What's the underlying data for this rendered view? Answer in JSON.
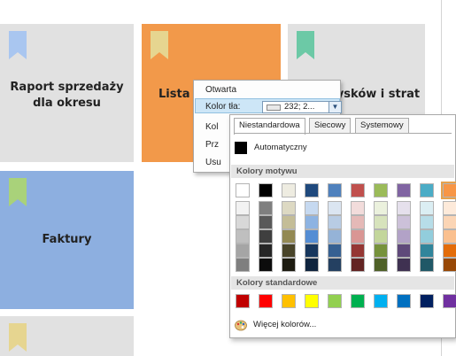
{
  "tiles": [
    {
      "label": "Raport sprzedaży dla okresu",
      "color": "#e1e1e1",
      "ribbon_color": "#a9c6f0"
    },
    {
      "label": "Lista P",
      "color": "#f2994a",
      "ribbon_color": "#e6d590"
    },
    {
      "label": "...ysków i strat",
      "color": "#e1e1e1",
      "ribbon_color": "#6cc9a6"
    },
    {
      "label": "Faktury",
      "color": "#8dafe0",
      "ribbon_color": "#a9d27a"
    },
    {
      "label": "",
      "color": "#e1e1e1",
      "ribbon_color": "#e6d590"
    }
  ],
  "context_menu": {
    "items": [
      "Otwarta",
      "Kolor tła:",
      "Kol",
      "Prz",
      "Usu"
    ],
    "combo_value": "232; 2...",
    "combo_arrow_icon": "chevron-down-icon"
  },
  "color_picker": {
    "tabs": [
      "Niestandardowa",
      "Siecowy",
      "Systemowy"
    ],
    "active_tab": 0,
    "automatic_label": "Automatyczny",
    "theme_colors_label": "Kolory motywu",
    "standard_colors_label": "Kolory standardowe",
    "more_colors_label": "Więcej kolorów...",
    "more_colors_icon": "palette-icon",
    "theme_base": [
      "#ffffff",
      "#000000",
      "#eeece1",
      "#1f497d",
      "#4f81bd",
      "#c0504d",
      "#9bbb59",
      "#8064a2",
      "#4bacc6",
      "#f79646"
    ],
    "theme_shades": [
      [
        "#f2f2f2",
        "#7f7f7f",
        "#ddd9c3",
        "#c6d9f0",
        "#dbe5f1",
        "#f2dcdb",
        "#ebf1dd",
        "#e5e0ec",
        "#dbeef3",
        "#fdeada"
      ],
      [
        "#d8d8d8",
        "#595959",
        "#c4bd97",
        "#8db3e2",
        "#b8cce4",
        "#e5b9b7",
        "#d7e3bc",
        "#ccc1d9",
        "#b7dde8",
        "#fbd5b5"
      ],
      [
        "#bfbfbf",
        "#3f3f3f",
        "#938953",
        "#548dd4",
        "#95b3d7",
        "#d99694",
        "#c3d69b",
        "#b2a2c7",
        "#92cddc",
        "#fac08f"
      ],
      [
        "#a5a5a5",
        "#262626",
        "#494429",
        "#17365d",
        "#366092",
        "#953734",
        "#76923c",
        "#5f497a",
        "#31859b",
        "#e36c09"
      ],
      [
        "#7f7f7f",
        "#0c0c0c",
        "#1d1b10",
        "#0f243e",
        "#244061",
        "#632423",
        "#4f6128",
        "#3f3151",
        "#205867",
        "#974806"
      ]
    ],
    "standard_colors": [
      "#c00000",
      "#ff0000",
      "#ffc000",
      "#ffff00",
      "#92d050",
      "#00b050",
      "#00b0f0",
      "#0070c0",
      "#002060",
      "#7030a0"
    ],
    "selected_color": "#f79646"
  }
}
